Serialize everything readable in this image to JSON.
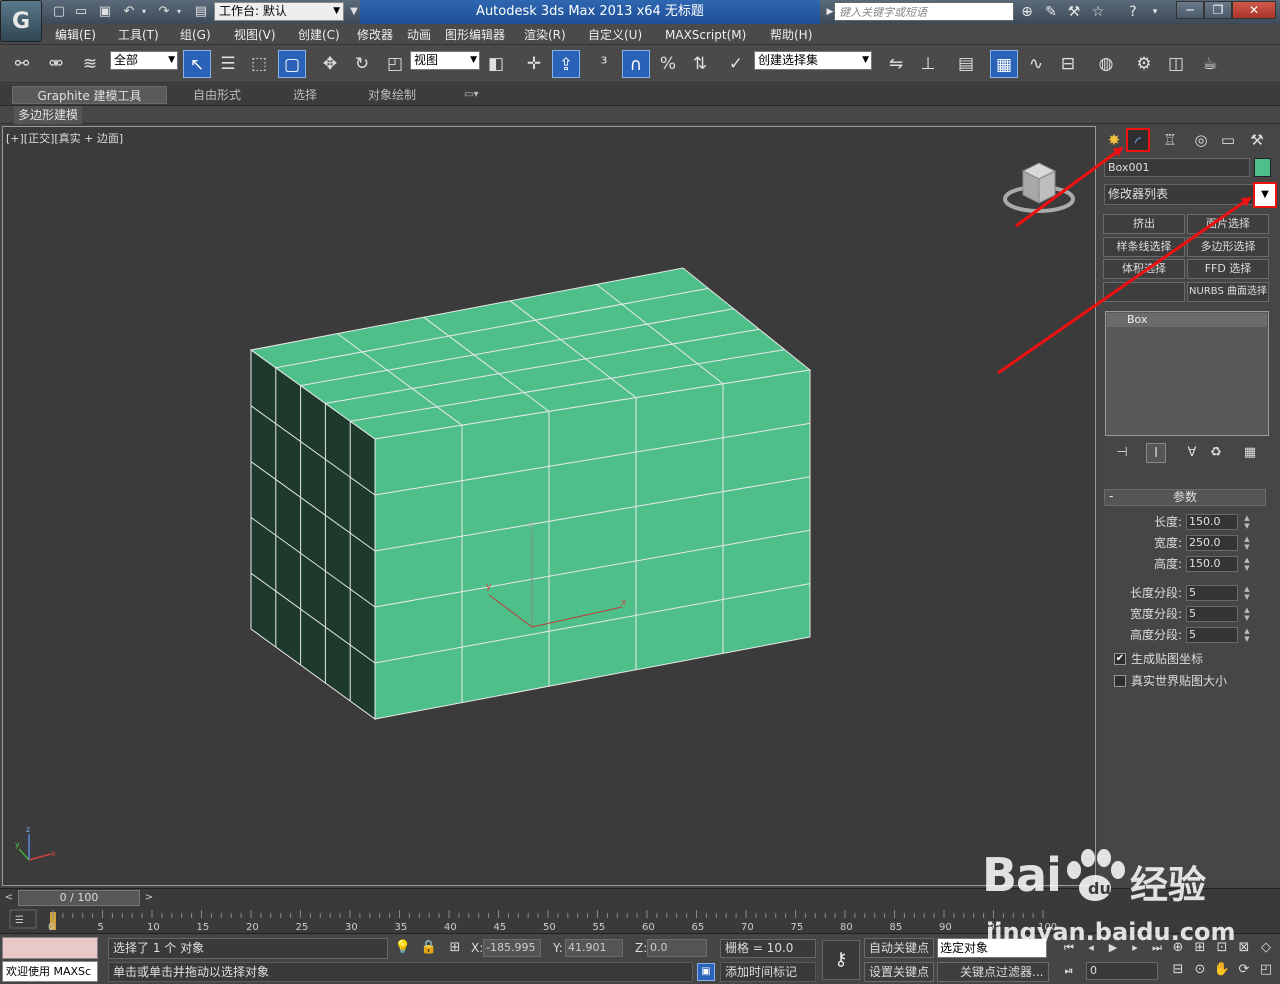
{
  "titlebar": {
    "workspace_label": "工作台: 默认",
    "app_title": "Autodesk 3ds Max  2013 x64      无标题",
    "search_placeholder": "键入关键字或短语"
  },
  "menu": [
    "编辑(E)",
    "工具(T)",
    "组(G)",
    "视图(V)",
    "创建(C)",
    "修改器",
    "动画",
    "图形编辑器",
    "渲染(R)",
    "自定义(U)",
    "MAXScript(M)",
    "帮助(H)"
  ],
  "toolbar": {
    "filter_select": "全部",
    "refcoord_select": "视图",
    "named_selset": "创建选择集"
  },
  "ribbon": {
    "tabs": [
      "Graphite 建模工具",
      "自由形式",
      "选择",
      "对象绘制"
    ],
    "sub_label": "多边形建模"
  },
  "viewport": {
    "label": "[+][正交][真实 + 边面]",
    "object_color": "#4fbf8a",
    "axis_labels": {
      "x": "x",
      "y": "y",
      "z": "z"
    }
  },
  "command_panel": {
    "object_name": "Box001",
    "modifier_list": "修改器列表",
    "modifier_buttons": [
      "挤出",
      "面片选择",
      "样条线选择",
      "多边形选择",
      "体积选择",
      "FFD 选择",
      "",
      "NURBS 曲面选择"
    ],
    "stack_item": "Box",
    "params_title": "参数",
    "params": [
      {
        "label": "长度:",
        "value": "150.0"
      },
      {
        "label": "宽度:",
        "value": "250.0"
      },
      {
        "label": "高度:",
        "value": "150.0"
      },
      {
        "label": "长度分段:",
        "value": "5"
      },
      {
        "label": "宽度分段:",
        "value": "5"
      },
      {
        "label": "高度分段:",
        "value": "5"
      }
    ],
    "checkboxes": [
      {
        "label": "生成贴图坐标",
        "checked": true
      },
      {
        "label": "真实世界贴图大小",
        "checked": false
      }
    ]
  },
  "timeline": {
    "slider_label": "0 / 100",
    "ticks": [
      "0",
      "5",
      "10",
      "15",
      "20",
      "25",
      "30",
      "35",
      "40",
      "45",
      "50",
      "55",
      "60",
      "65",
      "70",
      "75",
      "80",
      "85",
      "90",
      "95",
      "100"
    ]
  },
  "status": {
    "maxscript_text": "欢迎使用 MAXSc",
    "selection_text": "选择了 1 个 对象",
    "prompt_text": "单击或单击并拖动以选择对象",
    "x_label": "X:",
    "x_value": "-185.995",
    "y_label": "Y:",
    "y_value": "41.901",
    "z_label": "Z:",
    "z_value": "0.0",
    "grid_text": "栅格 = 10.0",
    "add_time_tag": "添加时间标记",
    "auto_key": "自动关键点",
    "set_key": "设置关键点",
    "key_select": "选定对象",
    "key_filters": "关键点过滤器...",
    "frame_value": "0"
  },
  "watermark": {
    "brand": "Bai",
    "brand_cn": "经验",
    "url": "jingyan.baidu.com"
  }
}
